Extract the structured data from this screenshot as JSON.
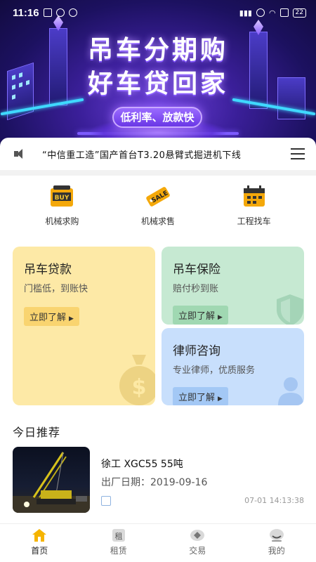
{
  "status_bar": {
    "time": "11:16",
    "battery": "22"
  },
  "banner": {
    "title_line1": "吊车分期购",
    "title_line2": "好车贷回家",
    "pill": "低利率、放款快"
  },
  "notice": {
    "text": "“中信重工造”国产首台T3.20悬臂式掘进机下线"
  },
  "shortcuts": [
    {
      "label": "机械求购",
      "icon": "buy-tag-icon",
      "icon_text": "BUY"
    },
    {
      "label": "机械求售",
      "icon": "sale-tag-icon",
      "icon_text": "SALE"
    },
    {
      "label": "工程找车",
      "icon": "calendar-truck-icon"
    }
  ],
  "cards": {
    "loan": {
      "title": "吊车贷款",
      "subtitle": "门槛低，到账快",
      "button": "立即了解"
    },
    "insurance": {
      "title": "吊车保险",
      "subtitle": "赔付秒到账",
      "button": "立即了解"
    },
    "lawyer": {
      "title": "律师咨询",
      "subtitle": "专业律师，优质服务",
      "button": "立即了解"
    }
  },
  "recommend": {
    "title": "今日推荐",
    "items": [
      {
        "name": "徐工 XGC55 55吨",
        "date": "出厂日期：2019-09-16",
        "time": "07-01 14:13:38"
      }
    ]
  },
  "nav": [
    {
      "label": "首页",
      "icon": "home-icon",
      "active": true,
      "icon_text": ""
    },
    {
      "label": "租赁",
      "icon": "rent-icon",
      "active": false,
      "icon_text": "租"
    },
    {
      "label": "交易",
      "icon": "trade-icon",
      "active": false,
      "icon_text": ""
    },
    {
      "label": "我的",
      "icon": "profile-icon",
      "active": false,
      "icon_text": ""
    }
  ],
  "colors": {
    "accent": "#f5b400",
    "loan_bg": "#fde9a6",
    "insurance_bg": "#c6e9d2",
    "lawyer_bg": "#c8dffc"
  }
}
